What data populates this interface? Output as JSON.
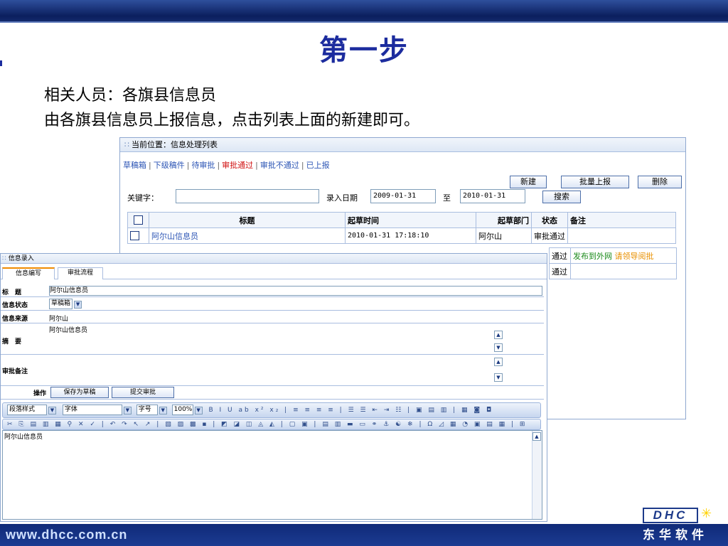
{
  "slide": {
    "title": "第一步",
    "line1": "相关人员：各旗县信息员",
    "line2": "由各旗县信息员上报信息，点击列表上面的新建即可。",
    "url": "www.dhcc.com.cn",
    "logo_text": "DHC",
    "logo_cn": "东华软件"
  },
  "list": {
    "header": "当前位置：信息处理列表",
    "tabs": [
      "草稿箱",
      "下级稿件",
      "待审批",
      "审批通过",
      "审批不通过",
      "已上报"
    ],
    "active_tab": "审批通过",
    "buttons": {
      "new": "新建",
      "batch": "批量上报",
      "delete": "删除",
      "search": "搜索"
    },
    "keyword_label": "关键字：",
    "date_label": "录入日期",
    "date_from": "2009-01-31",
    "to_label": "至",
    "date_to": "2010-01-31",
    "columns": [
      "",
      "标题",
      "起草时间",
      "起草部门",
      "状态",
      "备注"
    ],
    "rows": [
      {
        "title": "阿尔山信息员",
        "time": "2010-01-31 17:18:10",
        "dept": "阿尔山",
        "status": "审批通过",
        "note": ""
      }
    ],
    "extra_rows": [
      {
        "status": "通过",
        "note1": "发布到外网",
        "note2": "请领导阅批"
      },
      {
        "status": "通过",
        "note1": "",
        "note2": ""
      }
    ]
  },
  "form": {
    "header": "信息录入",
    "tabs": [
      "信息编写",
      "审批流程"
    ],
    "fields": {
      "title_label": "标　题",
      "title_value": "阿尔山信息员",
      "state_label": "信息状态",
      "state_value": "草稿箱",
      "source_label": "信息来源",
      "source_value": "阿尔山",
      "summary_label": "摘　要",
      "summary_value": "阿尔山信息员",
      "remark_label": "审批备注",
      "op_label": "操作"
    },
    "buttons": {
      "save": "保存为草稿",
      "submit": "提交审批"
    },
    "editor": {
      "style_label": "段落样式",
      "font_label": "字体",
      "size_label": "字号",
      "zoom": "100%",
      "content": "阿尔山信息员"
    }
  },
  "colors": {
    "accent": "#1c2c9e",
    "tab_active": "#d01010",
    "link": "#2c55b5",
    "publish": "#1a8a1a",
    "approve": "#e89000"
  }
}
